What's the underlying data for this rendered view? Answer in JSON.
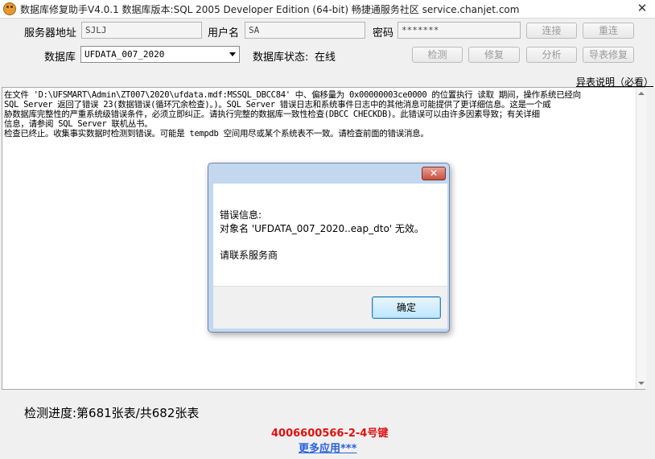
{
  "window": {
    "title": "数据库修复助手V4.0.1 数据库版本:SQL 2005 Developer Edition (64-bit)   畅捷通服务社区 service.chanjet.com",
    "close_glyph": "✕"
  },
  "form": {
    "server_label": "服务器地址",
    "server_value": "SJLJ",
    "user_label": "用户名",
    "user_value": "SA",
    "password_label": "密码",
    "password_value": "*******",
    "database_label": "数据库",
    "database_selected": "UFDATA_007_2020",
    "db_status_label": "数据库状态:",
    "db_status_value": "在线"
  },
  "toolbar": {
    "connect_label": "连接",
    "reconnect_label": "重连",
    "check_label": "检测",
    "repair_label": "修复",
    "analyze_label": "分析",
    "export_repair_label": "导表修复"
  },
  "help_link": "异表说明（必看）",
  "log": {
    "text": "在文件 'D:\\UFSMART\\Admin\\ZT007\\2020\\ufdata.mdf:MSSQL_DBCC84' 中、偏移量为 0x00000003ce0000 的位置执行 读取 期间，操作系统已经向\nSQL Server 返回了错误 23(数据错误(循环冗余检查)。)。SQL Server 错误日志和系统事件日志中的其他消息可能提供了更详细信息。这是一个威\n胁数据库完整性的严重系统级错误条件，必须立即纠正。请执行完整的数据库一致性检查(DBCC CHECKDB)。此错误可以由许多因素导致；有关详细\n信息，请参阅 SQL Server 联机丛书。\n检查已终止。收集事实数据时检测到错误。可能是 tempdb 空间用尽或某个系统表不一致。请检查前面的错误消息。"
  },
  "status": {
    "progress_text": "检测进度:第681张表/共682张表",
    "hotline": "4006600566-2-4号键",
    "more_apps_link": "更多应用***"
  },
  "dialog": {
    "heading": "错误信息:",
    "message": "对象名 'UFDATA_007_2020..eap_dto' 无效。",
    "contact": "请联系服务商",
    "ok_label": "确定",
    "close_glyph": "✕"
  },
  "colors": {
    "hotline": "#e01010",
    "link": "#2a62d8",
    "dialog_frame": "#c3d7ef",
    "ok_button": "#bee6fd"
  }
}
